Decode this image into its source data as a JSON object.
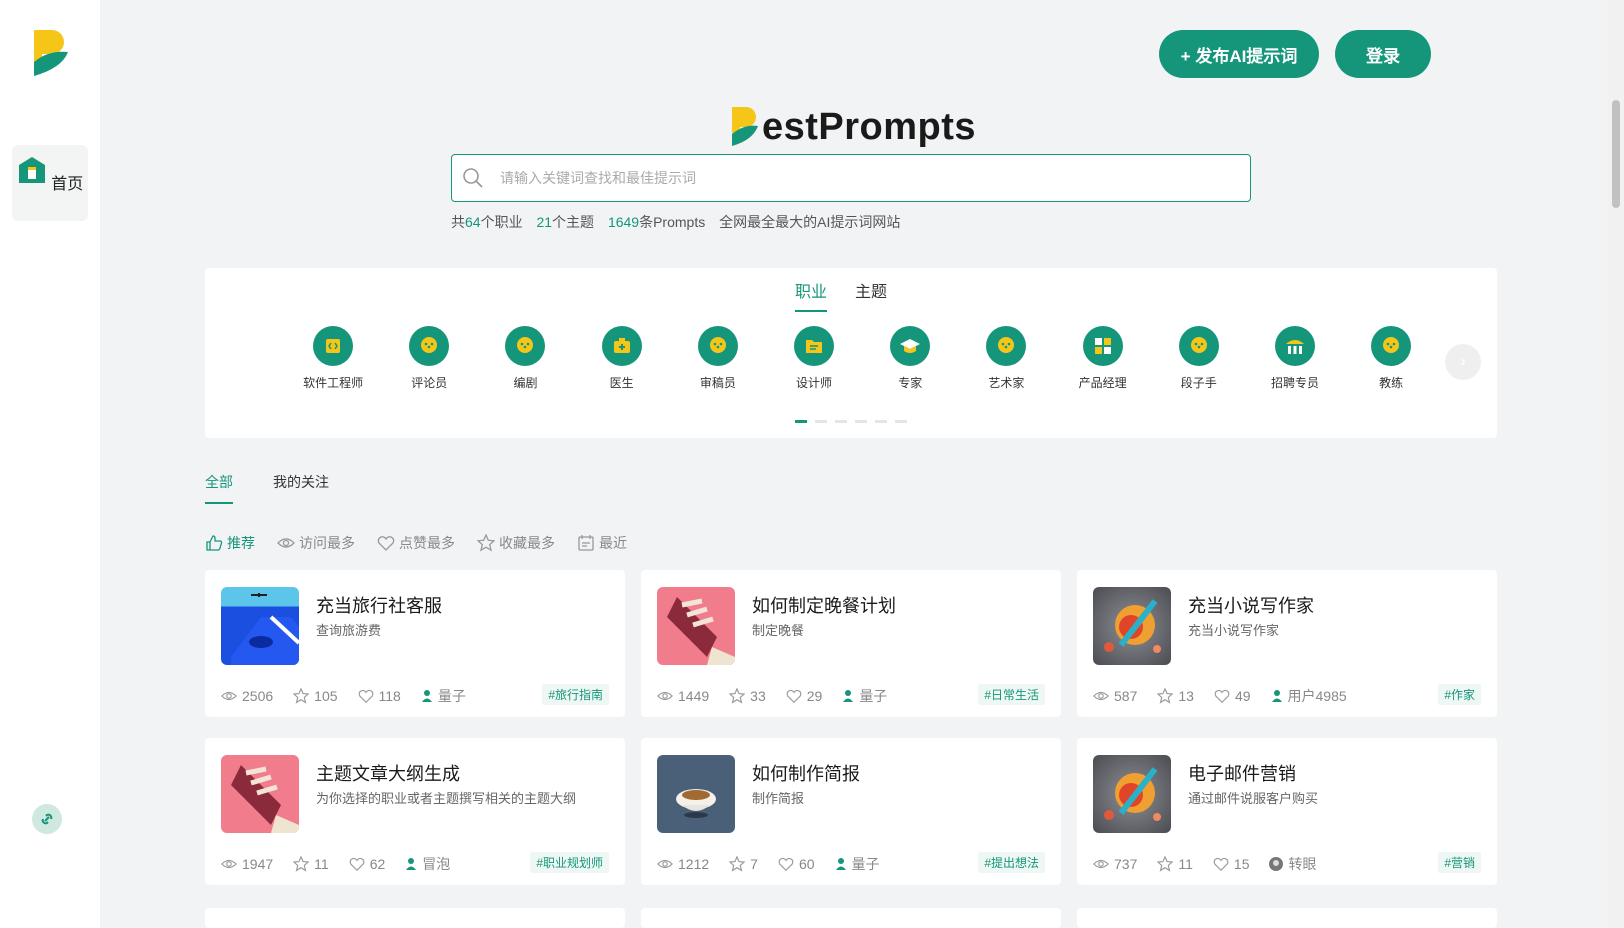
{
  "sidebar": {
    "home_label": "首页"
  },
  "header": {
    "publish_label": "+ 发布AI提示词",
    "login_label": "登录"
  },
  "brand": {
    "name": "estPrompts"
  },
  "search": {
    "placeholder": "请输入关键词查找和最佳提示词"
  },
  "stats": {
    "p1": "共",
    "professions": "64",
    "p2": "个职业",
    "topics": "21",
    "p3": "个主题",
    "prompts": "1649",
    "p4": "条Prompts",
    "tagline": "全网最全最大的AI提示词网站"
  },
  "category_tabs": [
    "职业",
    "主题"
  ],
  "categories": [
    "软件工程师",
    "评论员",
    "编剧",
    "医生",
    "审稿员",
    "设计师",
    "专家",
    "艺术家",
    "产品经理",
    "段子手",
    "招聘专员",
    "教练"
  ],
  "feed_tabs": [
    "全部",
    "我的关注"
  ],
  "sorts": [
    "推荐",
    "访问最多",
    "点赞最多",
    "收藏最多",
    "最近"
  ],
  "cards": [
    {
      "title": "充当旅行社客服",
      "desc": "查询旅游费",
      "views": "2506",
      "stars": "105",
      "likes": "118",
      "author": "量子",
      "tag": "#旅行指南"
    },
    {
      "title": "如何制定晚餐计划",
      "desc": "制定晚餐",
      "views": "1449",
      "stars": "33",
      "likes": "29",
      "author": "量子",
      "tag": "#日常生活"
    },
    {
      "title": "充当小说写作家",
      "desc": "充当小说写作家",
      "views": "587",
      "stars": "13",
      "likes": "49",
      "author": "用户4985",
      "tag": "#作家"
    },
    {
      "title": "主题文章大纲生成",
      "desc": "为你选择的职业或者主题撰写相关的主题大纲",
      "views": "1947",
      "stars": "11",
      "likes": "62",
      "author": "冒泡",
      "tag": "#职业规划师"
    },
    {
      "title": "如何制作简报",
      "desc": "制作简报",
      "views": "1212",
      "stars": "7",
      "likes": "60",
      "author": "量子",
      "tag": "#提出想法"
    },
    {
      "title": "电子邮件营销",
      "desc": "通过邮件说服客户购买",
      "views": "737",
      "stars": "11",
      "likes": "15",
      "author": "转眼",
      "tag": "#营销"
    }
  ],
  "colors": {
    "accent": "#15967a",
    "logo_yellow": "#f5c518"
  }
}
